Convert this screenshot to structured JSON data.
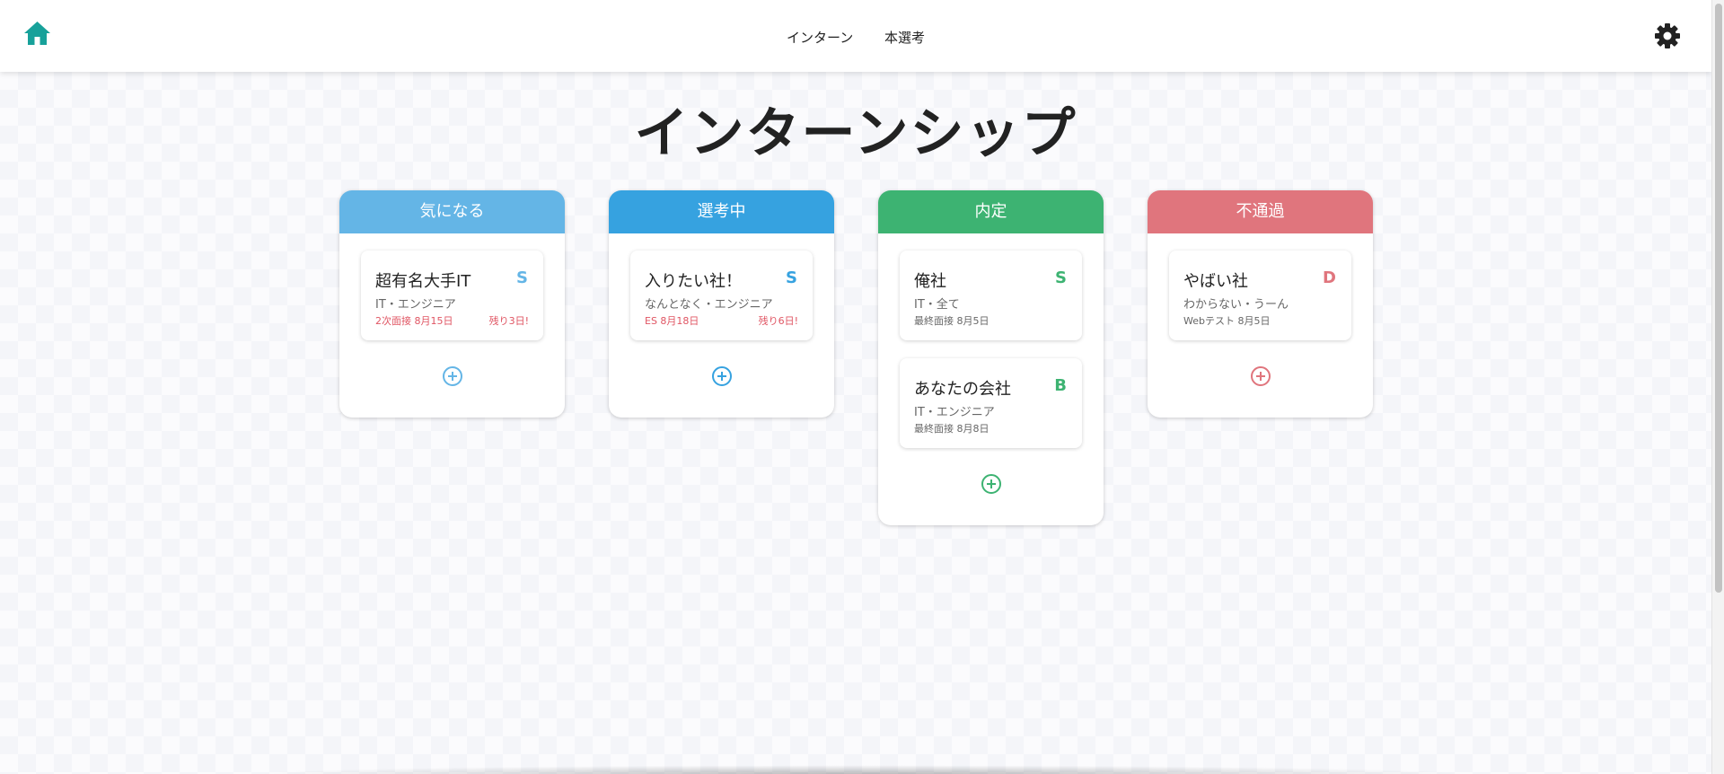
{
  "nav": {
    "links": [
      "インターン",
      "本選考"
    ]
  },
  "page": {
    "title": "インターンシップ"
  },
  "columns": [
    {
      "title": "気になる",
      "color": "#64b5e6",
      "cards": [
        {
          "name": "超有名大手IT",
          "rank": "S",
          "sub": "IT・エンジニア",
          "next": "2次面接 8月15日",
          "remain": "残り3日!"
        }
      ]
    },
    {
      "title": "選考中",
      "color": "#36a2e0",
      "cards": [
        {
          "name": "入りたい社！",
          "rank": "S",
          "sub": "なんとなく・エンジニア",
          "next": "ES 8月18日",
          "remain": "残り6日!"
        }
      ]
    },
    {
      "title": "内定",
      "color": "#3db372",
      "cards": [
        {
          "name": "俺社",
          "rank": "S",
          "sub": "IT・全て",
          "next": "最終面接 8月5日"
        },
        {
          "name": "あなたの会社",
          "rank": "B",
          "sub": "IT・エンジニア",
          "next": "最終面接 8月8日"
        }
      ]
    },
    {
      "title": "不通過",
      "color": "#e0757d",
      "cards": [
        {
          "name": "やばい社",
          "rank": "D",
          "sub": "わからない・うーん",
          "next": "Webテスト 8月5日"
        }
      ]
    }
  ],
  "colors": {
    "brand_home": "#17a19a",
    "urgent": "#e05563"
  }
}
